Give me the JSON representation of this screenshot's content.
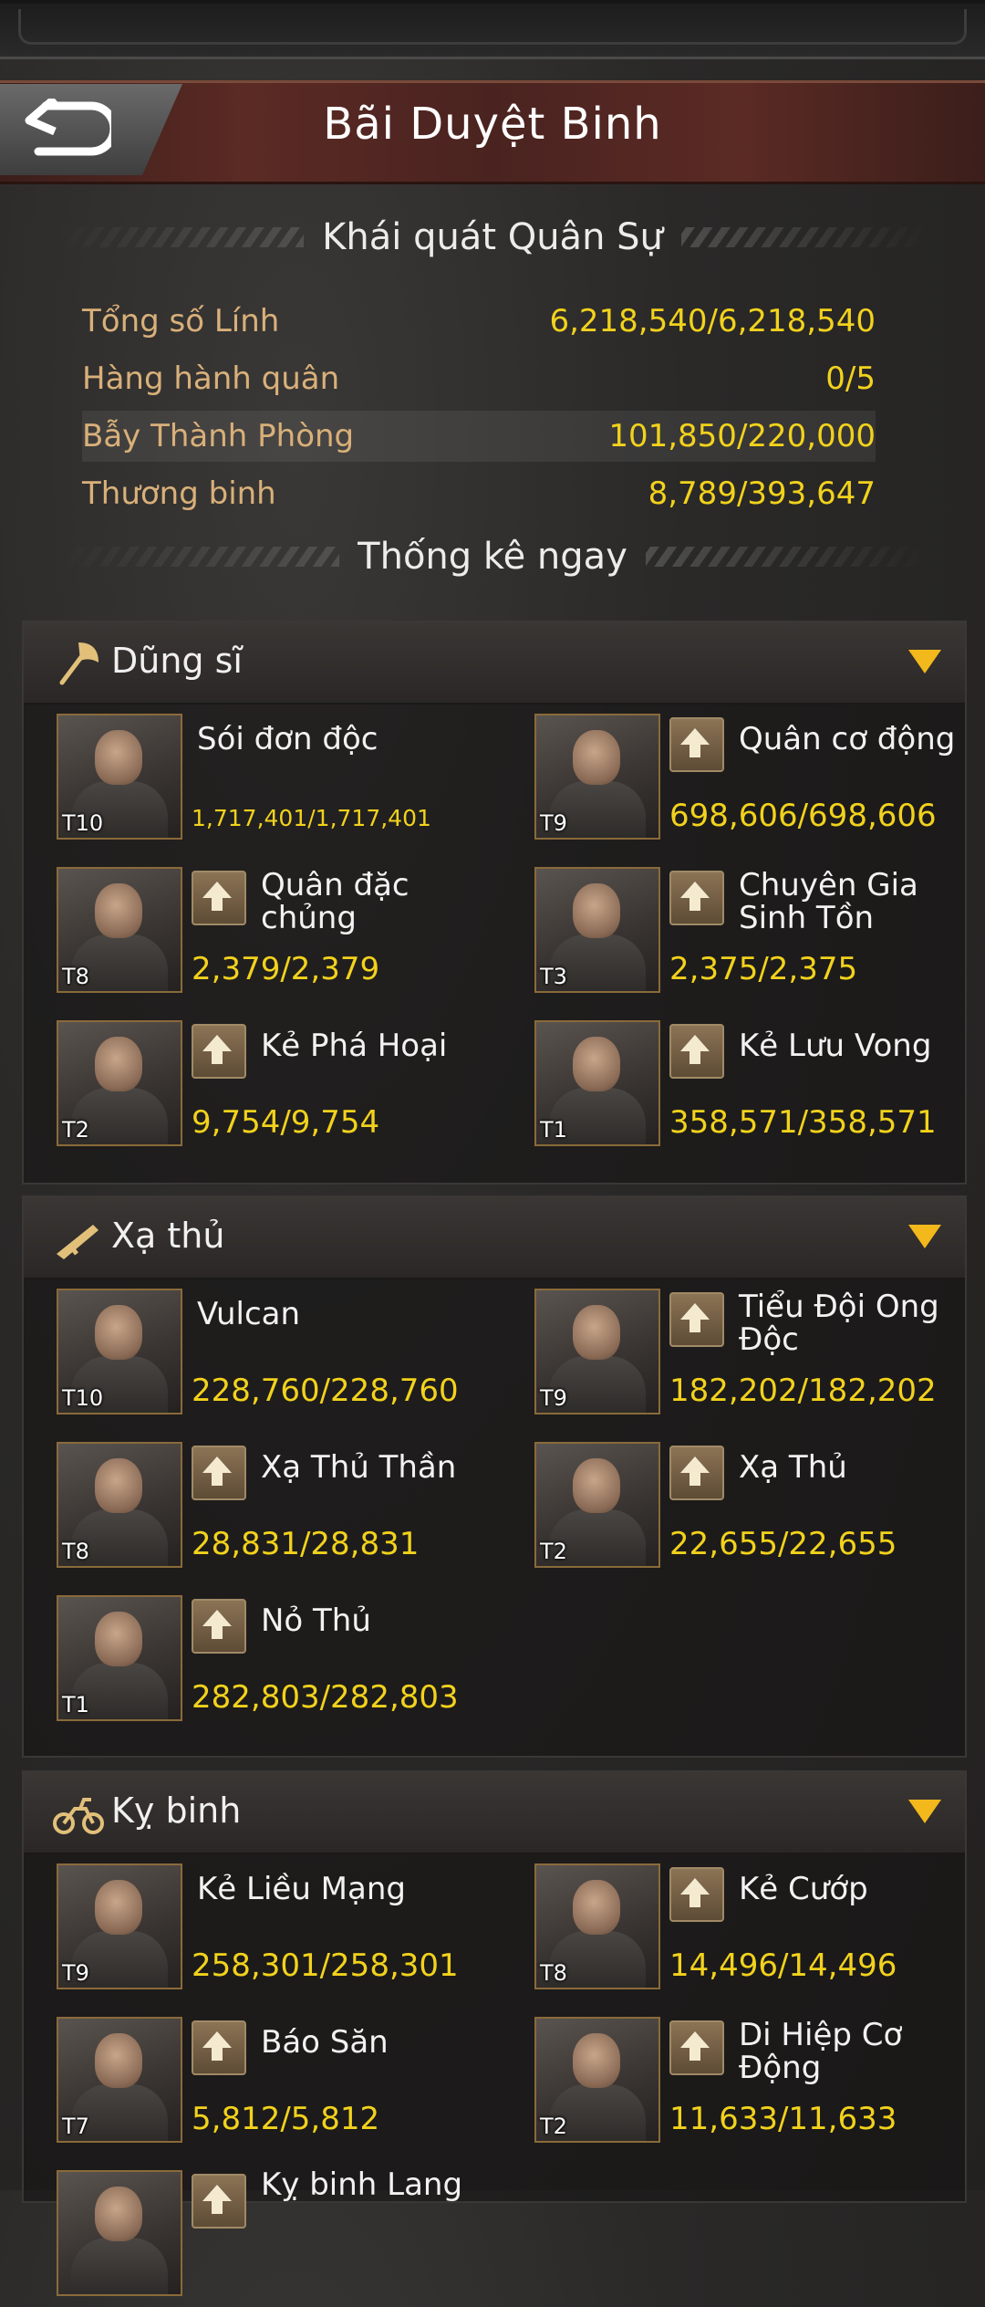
{
  "header": {
    "title": "Bãi Duyệt Binh",
    "back_icon": "back-arrow-icon"
  },
  "overview": {
    "heading": "Khái quát Quân Sự",
    "rows": [
      {
        "label": "Tổng số Lính",
        "value": "6,218,540/6,218,540"
      },
      {
        "label": "Hàng hành quân",
        "value": "0/5"
      },
      {
        "label": "Bẫy Thành Phòng",
        "value": "101,850/220,000"
      },
      {
        "label": "Thương binh",
        "value": "8,789/393,647"
      }
    ]
  },
  "stats_heading": "Thống kê ngay",
  "colors": {
    "accent_gold": "#f2d21c",
    "label_tan": "#d9b07a",
    "dropdown": "#f2b81c"
  },
  "categories": [
    {
      "title": "Dũng sĩ",
      "icon": "axe-icon",
      "units": [
        {
          "name": "Sói đơn độc",
          "tier": "T10",
          "count": "1,717,401/1,717,401",
          "upgrade": false
        },
        {
          "name": "Quân cơ động",
          "tier": "T9",
          "count": "698,606/698,606",
          "upgrade": true
        },
        {
          "name": "Quân đặc chủng",
          "tier": "T8",
          "count": "2,379/2,379",
          "upgrade": true
        },
        {
          "name": "Chuyên Gia Sinh Tồn",
          "tier": "T3",
          "count": "2,375/2,375",
          "upgrade": true
        },
        {
          "name": "Kẻ Phá Hoại",
          "tier": "T2",
          "count": "9,754/9,754",
          "upgrade": true
        },
        {
          "name": "Kẻ Lưu Vong",
          "tier": "T1",
          "count": "358,571/358,571",
          "upgrade": true
        }
      ]
    },
    {
      "title": "Xạ thủ",
      "icon": "rifle-icon",
      "units": [
        {
          "name": "Vulcan",
          "tier": "T10",
          "count": "228,760/228,760",
          "upgrade": false
        },
        {
          "name": "Tiểu Đội Ong Độc",
          "tier": "T9",
          "count": "182,202/182,202",
          "upgrade": true
        },
        {
          "name": "Xạ Thủ Thần",
          "tier": "T8",
          "count": "28,831/28,831",
          "upgrade": true
        },
        {
          "name": "Xạ Thủ",
          "tier": "T2",
          "count": "22,655/22,655",
          "upgrade": true
        },
        {
          "name": "Nỏ Thủ",
          "tier": "T1",
          "count": "282,803/282,803",
          "upgrade": true
        }
      ]
    },
    {
      "title": "Kỵ binh",
      "icon": "motorbike-icon",
      "units": [
        {
          "name": "Kẻ Liều Mạng",
          "tier": "T9",
          "count": "258,301/258,301",
          "upgrade": false
        },
        {
          "name": "Kẻ Cướp",
          "tier": "T8",
          "count": "14,496/14,496",
          "upgrade": true
        },
        {
          "name": "Báo Săn",
          "tier": "T7",
          "count": "5,812/5,812",
          "upgrade": true
        },
        {
          "name": "Di Hiệp Cơ Động",
          "tier": "T2",
          "count": "11,633/11,633",
          "upgrade": true
        },
        {
          "name": "Kỵ binh Lang",
          "tier": "",
          "count": "",
          "upgrade": true
        }
      ]
    }
  ]
}
